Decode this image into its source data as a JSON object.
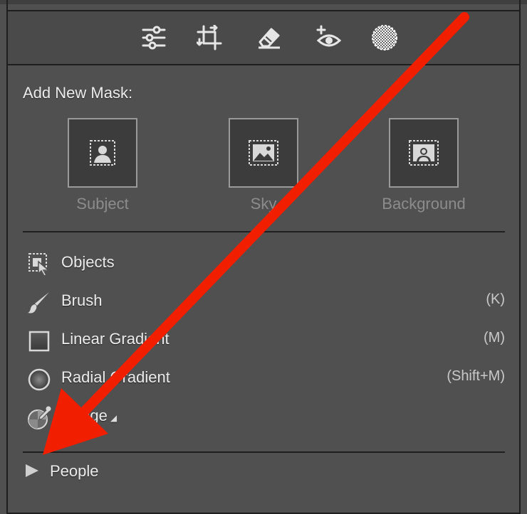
{
  "colors": {
    "panel_bg": "#505050",
    "toolbar_bg": "#4a4a4a",
    "border": "#1e1e1e",
    "annotation_arrow": "#f21e00",
    "disabled_text": "#8c8c8c"
  },
  "toolbar": {
    "tools": [
      {
        "icon": "sliders-icon"
      },
      {
        "icon": "crop-icon"
      },
      {
        "icon": "eraser-icon"
      },
      {
        "icon": "redeye-icon"
      },
      {
        "icon": "masking-icon",
        "active": true
      }
    ]
  },
  "add_mask": {
    "title": "Add New Mask:",
    "buttons": [
      {
        "label": "Subject",
        "icon": "subject-icon"
      },
      {
        "label": "Sky",
        "icon": "sky-icon"
      },
      {
        "label": "Background",
        "icon": "background-icon"
      }
    ]
  },
  "tools_list": [
    {
      "label": "Objects",
      "shortcut": "",
      "icon": "objects-icon"
    },
    {
      "label": "Brush",
      "shortcut": "(K)",
      "icon": "brush-icon"
    },
    {
      "label": "Linear Gradient",
      "shortcut": "(M)",
      "icon": "linear-gradient-icon"
    },
    {
      "label": "Radial Gradient",
      "shortcut": "(Shift+M)",
      "icon": "radial-gradient-icon"
    },
    {
      "label": "Range",
      "shortcut": "",
      "icon": "range-icon",
      "has_dropdown": true
    }
  ],
  "people": {
    "label": "People",
    "collapsed": true
  }
}
